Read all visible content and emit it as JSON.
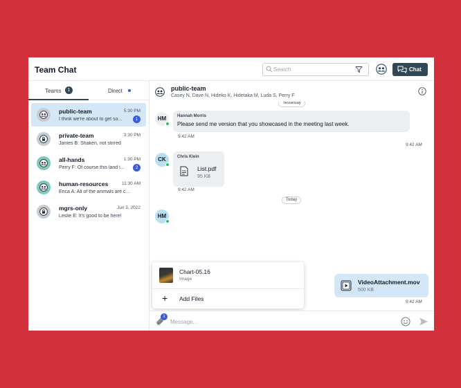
{
  "app": {
    "title": "Team Chat",
    "search_placeholder": "Search",
    "chat_button_label": "Chat"
  },
  "sidebar": {
    "tabs": [
      {
        "label": "Teams",
        "badge": "1",
        "active": true
      },
      {
        "label": "Direct",
        "dot": true
      }
    ],
    "teams": [
      {
        "name": "public-team",
        "time": "5:30 PM",
        "preview": "I think we're about to get so...",
        "badge": "1",
        "icon": "users-icon",
        "active": true
      },
      {
        "name": "private-team",
        "time": "3:30 PM",
        "preview": "James B: Shaken, not stirred",
        "icon": "lock-icon"
      },
      {
        "name": "all-hands",
        "time": "1:30 PM",
        "preview": "Perry F: Of course this land i...",
        "badge": "2",
        "icon": "users-icon"
      },
      {
        "name": "human-resources",
        "time": "11:30 AM",
        "preview": "Erica A: All of the animals are ca...",
        "icon": "users-icon"
      },
      {
        "name": "mgrs-only",
        "time": "Jun 3, 2022",
        "preview": "Leslie E: It's good to be here!",
        "icon": "lock-icon"
      }
    ]
  },
  "channel": {
    "name": "public-team",
    "members": "Casey N, Dave N, Hideko K, Hidetaka M, Luda S, Perry F"
  },
  "messages": {
    "day_yesterday": "Yesterday",
    "day_today": "Today",
    "m1": {
      "initials": "HM",
      "sender": "Hannah Morris",
      "text": "Please send me version that you showcased in the meeting last week.",
      "time": "9:42 AM"
    },
    "own_time_1": "9:42 AM",
    "m2": {
      "initials": "CK",
      "sender": "Chris Klein",
      "file_name": "List.pdf",
      "file_size": "95 KB",
      "time": "9:42 AM"
    },
    "m3": {
      "initials": "HM"
    },
    "own_file": {
      "name": "VideoAttachment.mov",
      "size": "500 KB",
      "time": "9:42 AM"
    }
  },
  "attach_menu": {
    "item_title": "Chart-05.16",
    "item_sub": "Image",
    "add_label": "Add Files"
  },
  "composer": {
    "placeholder": "Message...",
    "attach_badge": "1"
  },
  "colors": {
    "background": "#d2303a",
    "primary": "#2f4858",
    "accent_blue": "#3b5bdb",
    "active_row": "#d3e7f6",
    "online": "#22c55e"
  }
}
